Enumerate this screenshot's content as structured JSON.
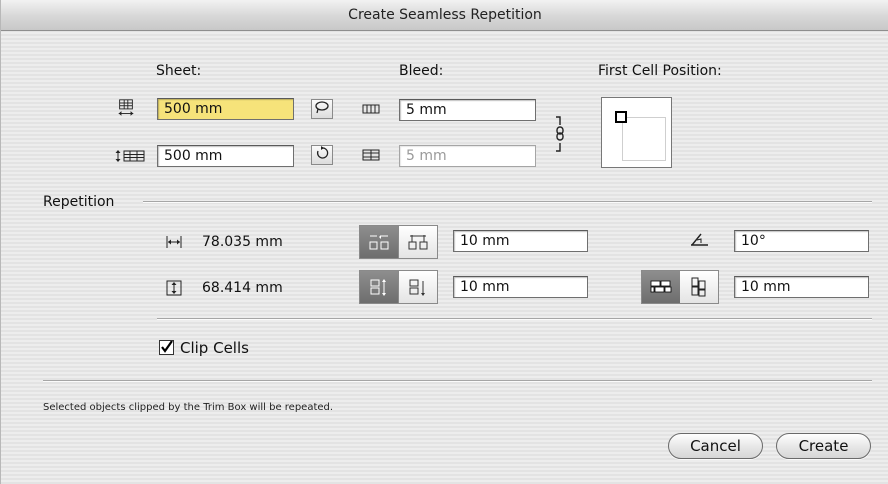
{
  "window": {
    "title": "Create Seamless Repetition"
  },
  "sheet": {
    "label": "Sheet:",
    "width_value": "500 mm",
    "height_value": "500 mm"
  },
  "bleed": {
    "label": "Bleed:",
    "horizontal_value": "5 mm",
    "vertical_value": "5 mm"
  },
  "first_cell": {
    "label": "First Cell Position:"
  },
  "repetition": {
    "label": "Repetition",
    "cell_width": "78.035 mm",
    "cell_height": "68.414 mm",
    "horizontal_offset": "10 mm",
    "vertical_offset": "10 mm",
    "angle": "10°",
    "shift": "10 mm"
  },
  "clip": {
    "label": "Clip Cells",
    "checked": true
  },
  "footer": {
    "note": "Selected objects clipped by the Trim Box will be repeated."
  },
  "buttons": {
    "cancel": "Cancel",
    "create": "Create"
  },
  "colors": {
    "highlight_field": "#f6e37a",
    "segment_selected": "#7a7a7a"
  }
}
